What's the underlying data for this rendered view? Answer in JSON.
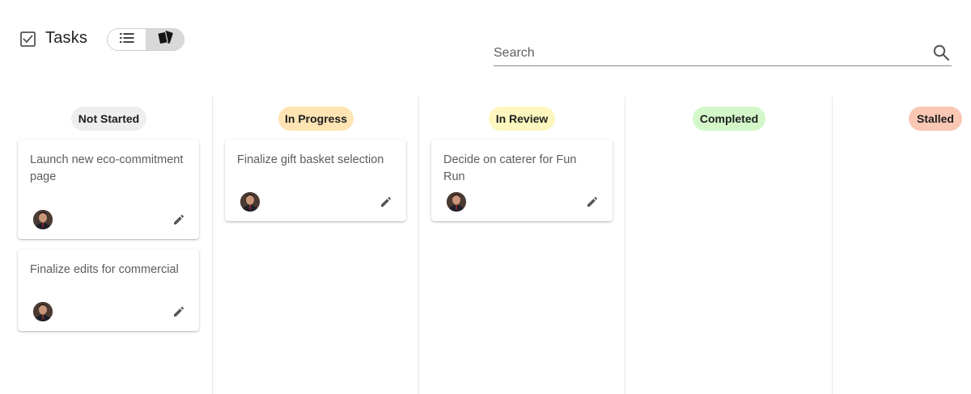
{
  "header": {
    "title": "Tasks",
    "title_icon": "checkbox-checked-icon",
    "view_toggle": {
      "options": [
        {
          "name": "list-view",
          "icon": "list-icon",
          "active": false
        },
        {
          "name": "card-view",
          "icon": "cards-icon",
          "active": true
        }
      ]
    },
    "search": {
      "placeholder": "Search",
      "value": "",
      "icon": "search-icon"
    }
  },
  "columns": [
    {
      "status": "Not Started",
      "color": "#eeeeee",
      "cards": [
        {
          "title": "Launch new eco-commitment page",
          "avatar": "avatar",
          "edit_icon": "pencil-icon"
        },
        {
          "title": "Finalize edits for commercial",
          "avatar": "avatar",
          "edit_icon": "pencil-icon"
        }
      ]
    },
    {
      "status": "In Progress",
      "color": "#fde4b2",
      "cards": [
        {
          "title": "Finalize gift basket selection",
          "avatar": "avatar",
          "edit_icon": "pencil-icon"
        }
      ]
    },
    {
      "status": "In Review",
      "color": "#fdf7bf",
      "cards": [
        {
          "title": "Decide on caterer for Fun Run",
          "avatar": "avatar",
          "edit_icon": "pencil-icon"
        }
      ]
    },
    {
      "status": "Completed",
      "color": "#d3f7c9",
      "cards": []
    },
    {
      "status": "Stalled",
      "color": "#f9c7b4",
      "cards": []
    }
  ]
}
